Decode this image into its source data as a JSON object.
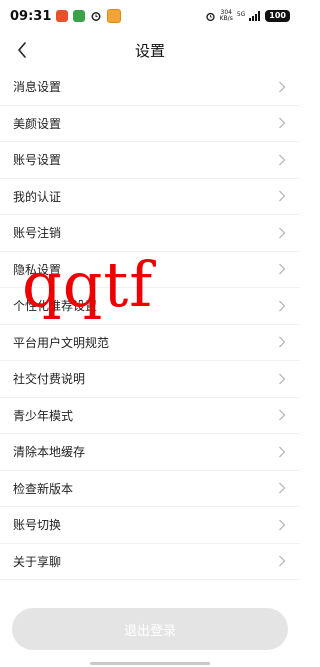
{
  "status_bar": {
    "time": "09:31",
    "network_speed_value": "304",
    "network_speed_unit": "KB/s",
    "signal_label": "5G",
    "battery": "100"
  },
  "header": {
    "title": "设置",
    "back_icon": "chevron-left-icon"
  },
  "settings": {
    "items": [
      {
        "label": "消息设置"
      },
      {
        "label": "美颜设置"
      },
      {
        "label": "账号设置"
      },
      {
        "label": "我的认证"
      },
      {
        "label": "账号注销"
      },
      {
        "label": "隐私设置"
      },
      {
        "label": "个性化推荐设置"
      },
      {
        "label": "平台用户文明规范"
      },
      {
        "label": "社交付费说明"
      },
      {
        "label": "青少年模式"
      },
      {
        "label": "清除本地缓存"
      },
      {
        "label": "检查新版本"
      },
      {
        "label": "账号切换"
      },
      {
        "label": "关于享聊"
      }
    ]
  },
  "watermark": "qqtf",
  "logout_button": "退出登录",
  "colors": {
    "watermark": "#ee0000",
    "logout_bg": "#e4e4e4",
    "chevron": "#b8b8b8"
  }
}
